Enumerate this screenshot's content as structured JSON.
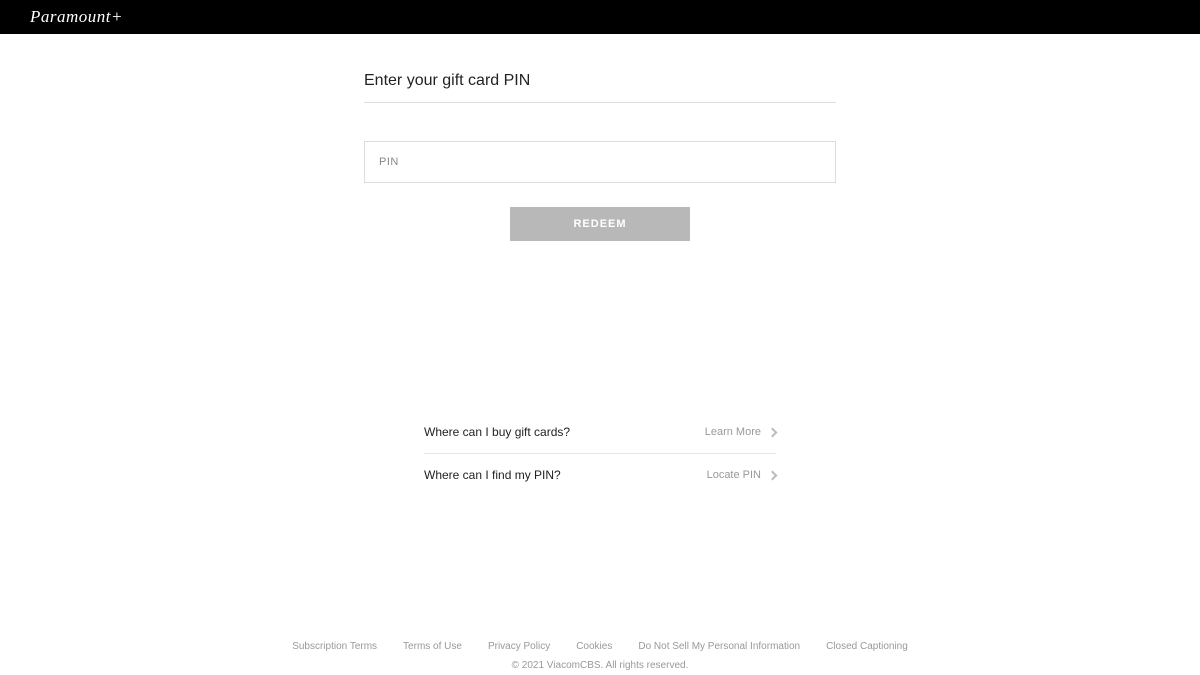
{
  "header": {
    "logo_text": "Paramount+"
  },
  "main": {
    "title": "Enter your gift card PIN",
    "pin_placeholder": "PIN",
    "redeem_label": "REDEEM"
  },
  "help": {
    "rows": [
      {
        "question": "Where can I buy gift cards?",
        "action_label": "Learn More"
      },
      {
        "question": "Where can I find my PIN?",
        "action_label": "Locate PIN"
      }
    ]
  },
  "footer": {
    "links": [
      "Subscription Terms",
      "Terms of Use",
      "Privacy Policy",
      "Cookies",
      "Do Not Sell My Personal Information",
      "Closed Captioning"
    ],
    "copyright": "© 2021 ViacomCBS. All rights reserved."
  }
}
